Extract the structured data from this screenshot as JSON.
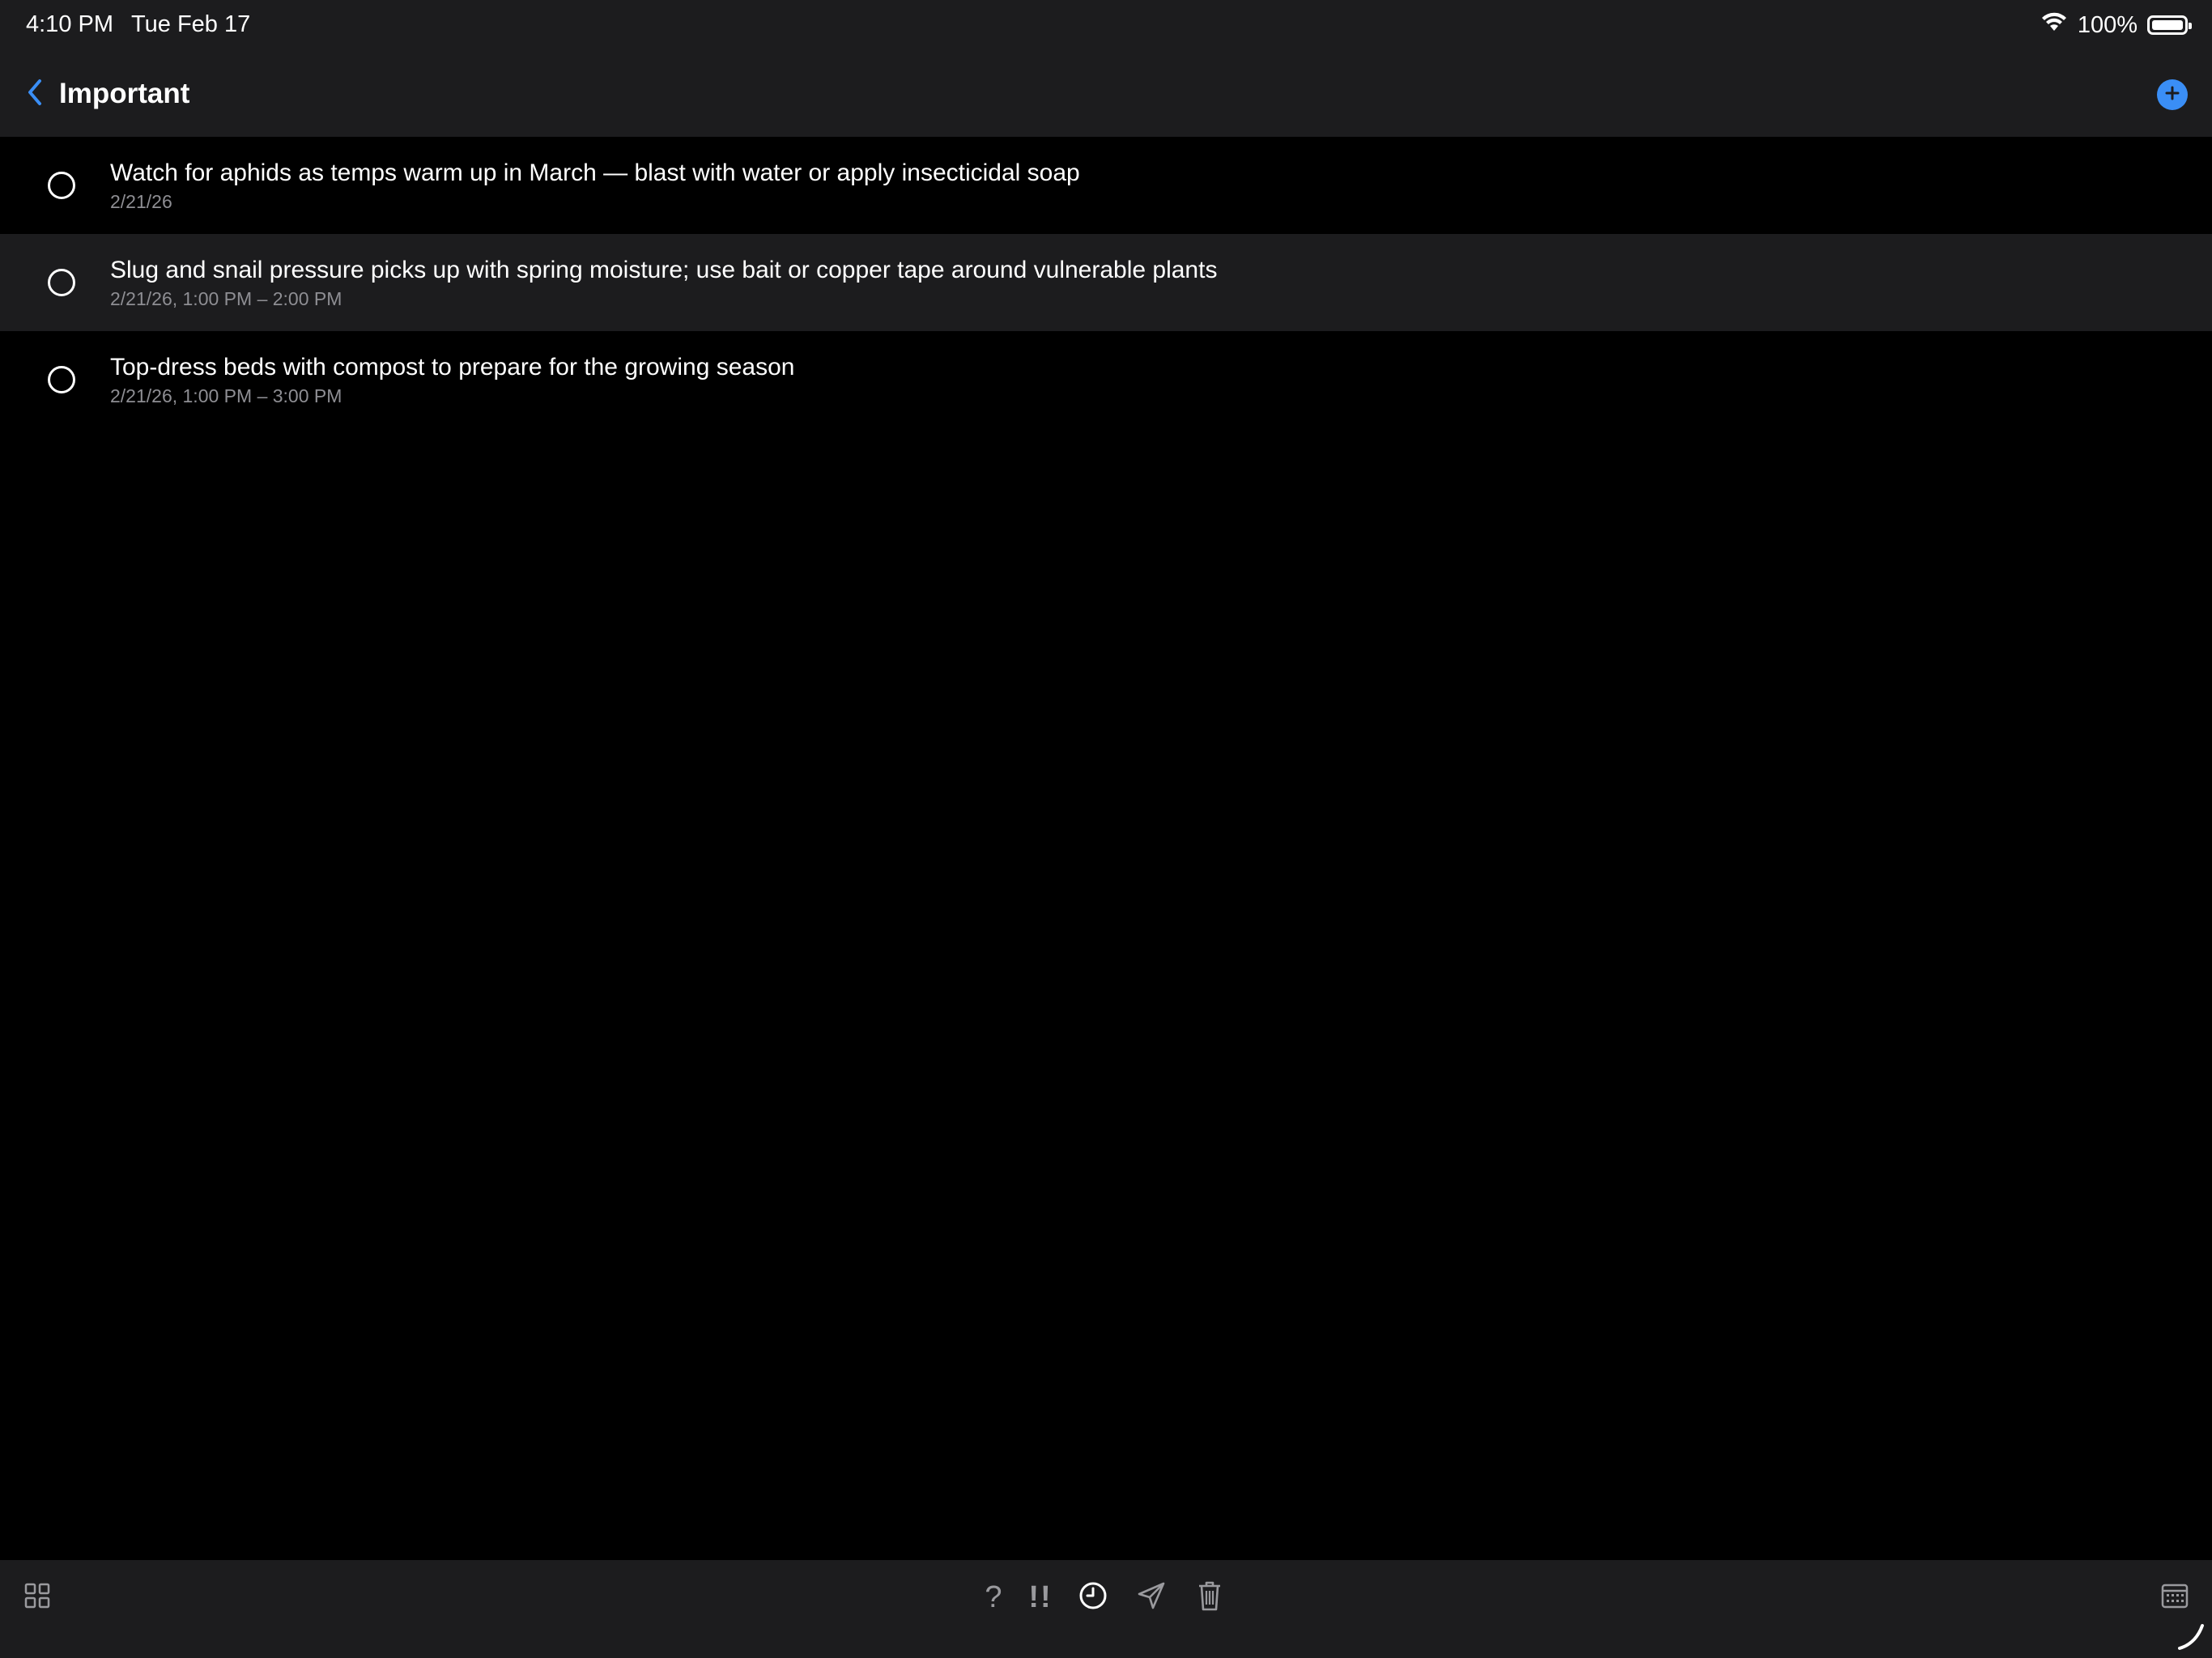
{
  "status_bar": {
    "time": "4:10 PM",
    "date": "Tue Feb 17",
    "battery_text": "100%",
    "icons": [
      "wifi-icon",
      "battery-icon"
    ]
  },
  "nav": {
    "title": "Important",
    "back_icon": "chevron-left-icon",
    "add_icon": "plus-circle-icon",
    "accent_color": "#3a8ef6"
  },
  "tasks": [
    {
      "title": "Watch for aphids as temps warm up in March — blast with water or apply insecticidal soap",
      "subtitle": "2/21/26",
      "selected": false
    },
    {
      "title": "Slug and snail pressure picks up with spring moisture; use bait or copper tape around vulnerable plants",
      "subtitle": "2/21/26, 1:00 PM – 2:00 PM",
      "selected": true
    },
    {
      "title": "Top-dress beds with compost to prepare for the growing season",
      "subtitle": "2/21/26, 1:00 PM – 3:00 PM",
      "selected": false
    }
  ],
  "toolbar": {
    "grid_icon": "grid-icon",
    "question_label": "?",
    "priority_label": "!!",
    "clock_icon": "clock-icon",
    "send_icon": "send-icon",
    "trash_icon": "trash-icon",
    "calendar_icon": "calendar-icon"
  }
}
